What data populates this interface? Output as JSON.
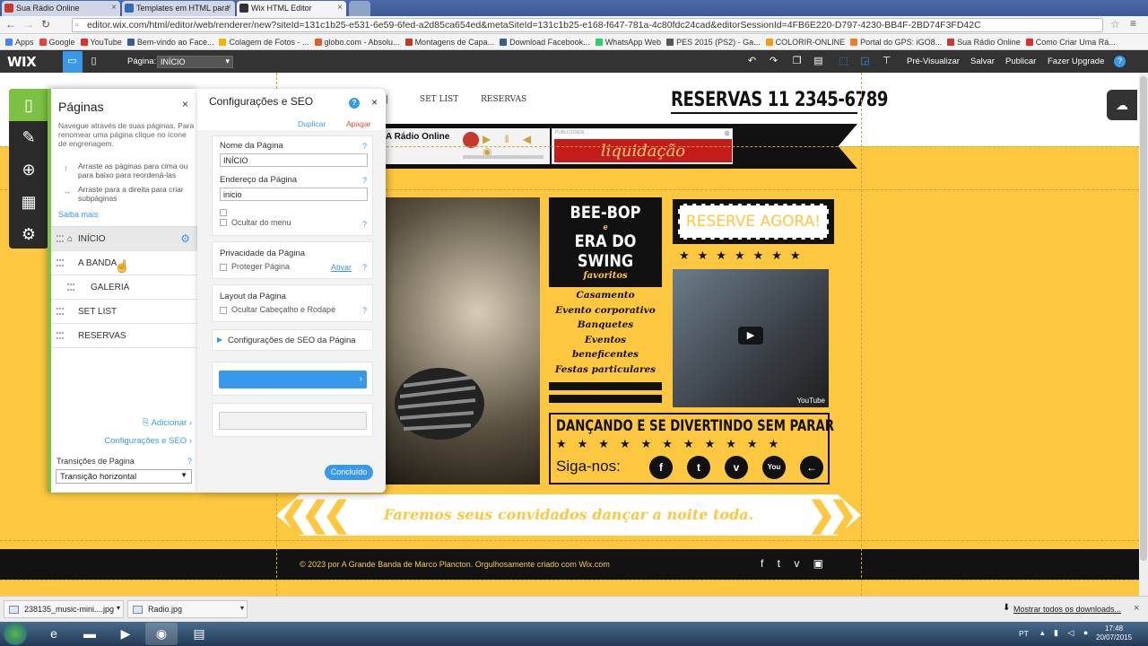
{
  "browser": {
    "tabs": [
      {
        "label": "Sua Rádio Online",
        "favicon_color": "#c8382b"
      },
      {
        "label": "Templates em HTML para",
        "favicon_color": "#2e6db4"
      },
      {
        "label": "Wix HTML Editor",
        "favicon_color": "#333333"
      }
    ],
    "url": "editor.wix.com/html/editor/web/renderer/new?siteId=131c1b25-e531-6e59-6fed-a2d85ca654ed&metaSiteId=131c1b25-e168-f647-781a-4c80fdc24cad&editorSessionId=4FB6E220-D797-4230-BB4F-2BD74F3FD42C",
    "bookmarks": [
      {
        "label": "Apps",
        "color": "#4285f4"
      },
      {
        "label": "Google",
        "color": "#ea4335"
      },
      {
        "label": "YouTube",
        "color": "#e52d27"
      },
      {
        "label": "Bem-vindo ao Face...",
        "color": "#3b5998"
      },
      {
        "label": "Colagem de Fotos - ...",
        "color": "#f4b400"
      },
      {
        "label": "globo.com - Absolu...",
        "color": "#e85d25"
      },
      {
        "label": "Montagens de Capa...",
        "color": "#c0392b"
      },
      {
        "label": "Download Facebook...",
        "color": "#3b5998"
      },
      {
        "label": "WhatsApp Web",
        "color": "#25d366"
      },
      {
        "label": "PES 2015 (PS2) - Ga...",
        "color": "#555555"
      },
      {
        "label": "COLORIR-ONLINE",
        "color": "#f39c12"
      },
      {
        "label": "Portal do GPS: iGO8...",
        "color": "#e67e22"
      },
      {
        "label": "Sua Rádio Online",
        "color": "#c8382b"
      },
      {
        "label": "Como Criar Uma Rá...",
        "color": "#e52d27"
      }
    ]
  },
  "wix": {
    "logo": "WIX",
    "page_label": "Página:",
    "page_value": "INÍCIO",
    "preview": "Pré-Visualizar",
    "save": "Salvar",
    "publish": "Publicar",
    "upgrade": "Fazer Upgrade",
    "accent": "#3899ec"
  },
  "pages_panel": {
    "title": "Páginas",
    "description": "Navegue através de suas páginas. Para renomear uma página clique no ícone de engrenagem.",
    "tip1": "Arraste as páginas para cima ou para baixo para reordená-las",
    "tip2": "Arraste para a direita para criar subpáginas",
    "learn_more": "Saiba mais",
    "pages": [
      {
        "label": "INÍCIO",
        "home": true,
        "selected": true,
        "sub": false
      },
      {
        "label": "A BANDA",
        "home": false,
        "selected": false,
        "sub": false
      },
      {
        "label": "GALERIA",
        "home": false,
        "selected": false,
        "sub": true
      },
      {
        "label": "SET LIST",
        "home": false,
        "selected": false,
        "sub": false
      },
      {
        "label": "RESERVAS",
        "home": false,
        "selected": false,
        "sub": false
      }
    ],
    "add": "Adicionar",
    "seo_settings": "Configurações e SEO",
    "transitions_label": "Transições de Página",
    "transitions_help": "?",
    "transition_value": "Transição horizontal",
    "accent": "#7cc143"
  },
  "seo_panel": {
    "title": "Configurações e SEO",
    "help": "?",
    "duplicate": "Duplicar",
    "delete": "Apagar",
    "page_name_label": "Nome da Página",
    "page_name_value": "INÍCIO",
    "page_address_label": "Endereço da Página",
    "page_address_value": "inicio",
    "hide_menu": "Ocultar do menu",
    "privacy_label": "Privacidade da Página",
    "protect_page": "Proteger Página",
    "activate": "Ativar",
    "layout_label": "Layout da Página",
    "hide_header_footer": "Ocultar Cabeçalho e Rodapé",
    "seo_settings": "Configurações de SEO da Página",
    "done": "Concluído"
  },
  "site": {
    "nav": [
      "SET LIST",
      "RESERVAS"
    ],
    "reservations": "RESERVAS  11 2345-6789",
    "radio": "A Rádio Online",
    "ad_label": "PUBLICIDADE",
    "ad_text": "liquidação",
    "beebop_1": "BEE-BOP",
    "beebop_e": "e",
    "beebop_2": "ERA DO SWING",
    "beebop_fav": "favoritos",
    "events": [
      "Casamento",
      "Evento corporativo",
      "Banquetes",
      "Eventos",
      "beneficentes",
      "Festas particulares"
    ],
    "reserve_now": "RESERVE AGORA!",
    "dance_title": "DANÇANDO E SE DIVERTINDO SEM PARAR",
    "follow": "Siga-nos:",
    "social": [
      "f",
      "t",
      "v",
      "You",
      "←"
    ],
    "banner": "Faremos seus convidados dançar a noite toda.",
    "footer": "© 2023 por A Grande Banda de Marco Plancton. Orgulhosamente criado com Wix.com",
    "footer_icons": "f t v ▣",
    "youtube": "YouTube",
    "yellow": "#fdc83f"
  },
  "downloads": {
    "items": [
      "238135_music-mini....jpg",
      "Radio.jpg"
    ],
    "show_all": "Mostrar todos os downloads..."
  },
  "taskbar": {
    "language": "PT",
    "time": "17:48",
    "date": "20/07/2015"
  }
}
